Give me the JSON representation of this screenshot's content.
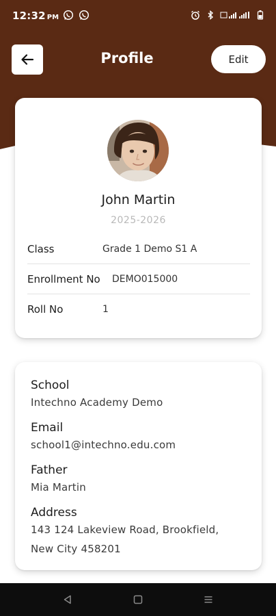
{
  "colors": {
    "brand": "#5a2a14",
    "card": "#ffffff",
    "muted_text": "#b8b8b8",
    "nav_bar": "#0d0d0d"
  },
  "status_bar": {
    "time": "12:32",
    "ampm": "PM",
    "left_icons": [
      "whatsapp-icon",
      "whatsapp-icon"
    ],
    "right_icons": [
      "alarm-icon",
      "bluetooth-icon",
      "signal-icon",
      "battery-icon"
    ]
  },
  "app_bar": {
    "back_icon": "arrow-left-icon",
    "title": "Profile",
    "edit_label": "Edit"
  },
  "profile": {
    "name": "John Martin",
    "academic_year": "2025-2026",
    "rows": [
      {
        "label": "Class",
        "value": "Grade 1 Demo S1 A"
      },
      {
        "label": "Enrollment No",
        "value": "DEMO015000"
      },
      {
        "label": "Roll No",
        "value": "1"
      }
    ]
  },
  "details": [
    {
      "label": "School",
      "value": "Intechno Academy Demo"
    },
    {
      "label": "Email",
      "value": "school1@intechno.edu.com"
    },
    {
      "label": "Father",
      "value": "Mia Martin"
    },
    {
      "label": "Address",
      "value_line1": "143 124 Lakeview Road, Brookfield,",
      "value_line2": "New City 458201"
    }
  ],
  "nav": [
    "back-nav-icon",
    "home-nav-icon",
    "recents-nav-icon"
  ]
}
